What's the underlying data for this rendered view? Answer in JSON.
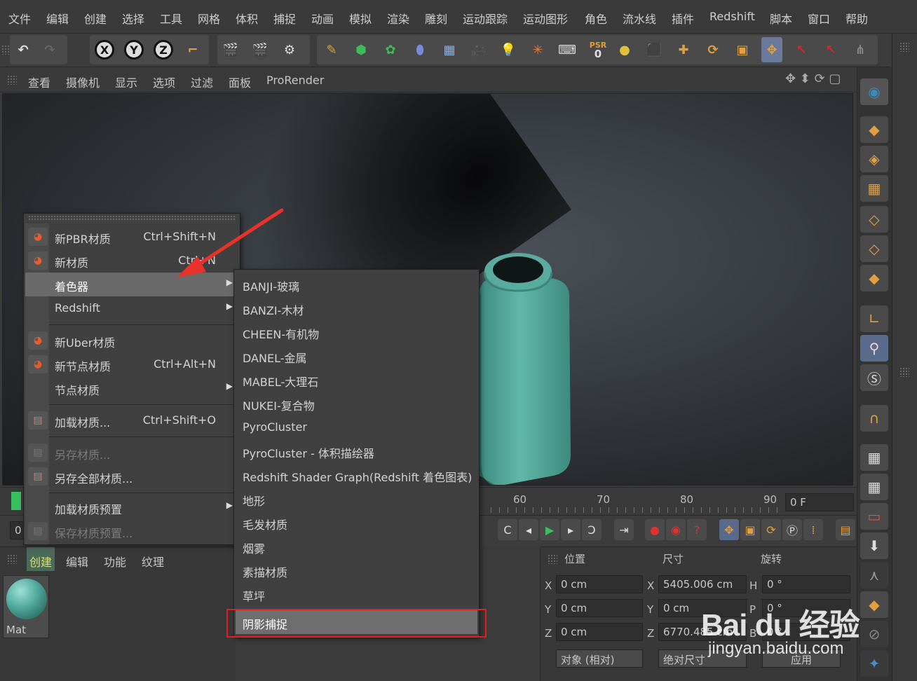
{
  "menubar": {
    "items": [
      "文件",
      "编辑",
      "创建",
      "选择",
      "工具",
      "网格",
      "体积",
      "捕捉",
      "动画",
      "模拟",
      "渲染",
      "雕刻",
      "运动跟踪",
      "运动图形",
      "角色",
      "流水线",
      "插件",
      "Redshift",
      "脚本",
      "窗口",
      "帮助"
    ]
  },
  "toolbar": {
    "axis_labels": [
      "X",
      "Y",
      "Z"
    ],
    "psr_label": "PSR",
    "psr_value": "0"
  },
  "viewport_menu": {
    "items": [
      "查看",
      "摄像机",
      "显示",
      "选项",
      "过滤",
      "面板",
      "ProRender"
    ]
  },
  "context_menu": {
    "items": [
      {
        "label": "新PBR材质",
        "shortcut": "Ctrl+Shift+N",
        "icon": "material-icon",
        "submenu": false,
        "disabled": false
      },
      {
        "label": "新材质",
        "shortcut": "Ctrl+N",
        "icon": "material-icon",
        "submenu": false,
        "disabled": false
      },
      {
        "label": "着色器",
        "shortcut": "",
        "icon": "",
        "submenu": true,
        "disabled": false,
        "highlighted": true
      },
      {
        "label": "Redshift",
        "shortcut": "",
        "icon": "",
        "submenu": true,
        "disabled": false
      },
      {
        "label": "新Uber材质",
        "shortcut": "",
        "icon": "material-icon",
        "submenu": false,
        "disabled": false
      },
      {
        "label": "新节点材质",
        "shortcut": "Ctrl+Alt+N",
        "icon": "material-icon",
        "submenu": false,
        "disabled": false
      },
      {
        "label": "节点材质",
        "shortcut": "",
        "icon": "",
        "submenu": true,
        "disabled": false
      },
      {
        "label": "加载材质...",
        "shortcut": "Ctrl+Shift+O",
        "icon": "load-icon",
        "submenu": false,
        "disabled": false
      },
      {
        "label": "另存材质...",
        "shortcut": "",
        "icon": "save-icon",
        "submenu": false,
        "disabled": true
      },
      {
        "label": "另存全部材质...",
        "shortcut": "",
        "icon": "save-all-icon",
        "submenu": false,
        "disabled": false
      },
      {
        "label": "加载材质预置",
        "shortcut": "",
        "icon": "",
        "submenu": true,
        "disabled": false
      },
      {
        "label": "保存材质预置...",
        "shortcut": "",
        "icon": "preset-icon",
        "submenu": false,
        "disabled": true
      }
    ]
  },
  "shader_submenu": {
    "items": [
      "BANJI-玻璃",
      "BANZI-木材",
      "CHEEN-有机物",
      "DANEL-金属",
      "MABEL-大理石",
      "NUKEI-复合物",
      "PyroCluster",
      "PyroCluster - 体积描绘器",
      "Redshift Shader Graph(Redshift 着色图表)",
      "地形",
      "毛发材质",
      "烟雾",
      "素描材质",
      "草坪",
      "阴影捕捉"
    ],
    "selected": "阴影捕捉"
  },
  "timeline": {
    "ticks": [
      "60",
      "70",
      "80",
      "90"
    ],
    "frame_field": "0 F",
    "start_field": "0"
  },
  "material_panel": {
    "tabs": [
      "创建",
      "编辑",
      "功能",
      "纹理"
    ],
    "material_name": "Mat"
  },
  "coordinates": {
    "headers": [
      "位置",
      "尺寸",
      "旋转"
    ],
    "position": {
      "X": "0 cm",
      "Y": "0 cm",
      "Z": "0 cm"
    },
    "size": {
      "X": "5405.006 cm",
      "Y": "0 cm",
      "Z": "6770.485 cm"
    },
    "rotation": {
      "H": "0 °",
      "P": "0 °",
      "B": "0 °"
    },
    "mode_dropdown": "对象 (相对)",
    "size_mode": "绝对尺寸",
    "apply_button": "应用"
  },
  "watermark": {
    "brand": "Bai du 经验",
    "url": "jingyan.baidu.com"
  },
  "colors": {
    "accent_highlight": "#e02020",
    "arrow": "#e8322a",
    "bottle": "#4fa79a"
  }
}
